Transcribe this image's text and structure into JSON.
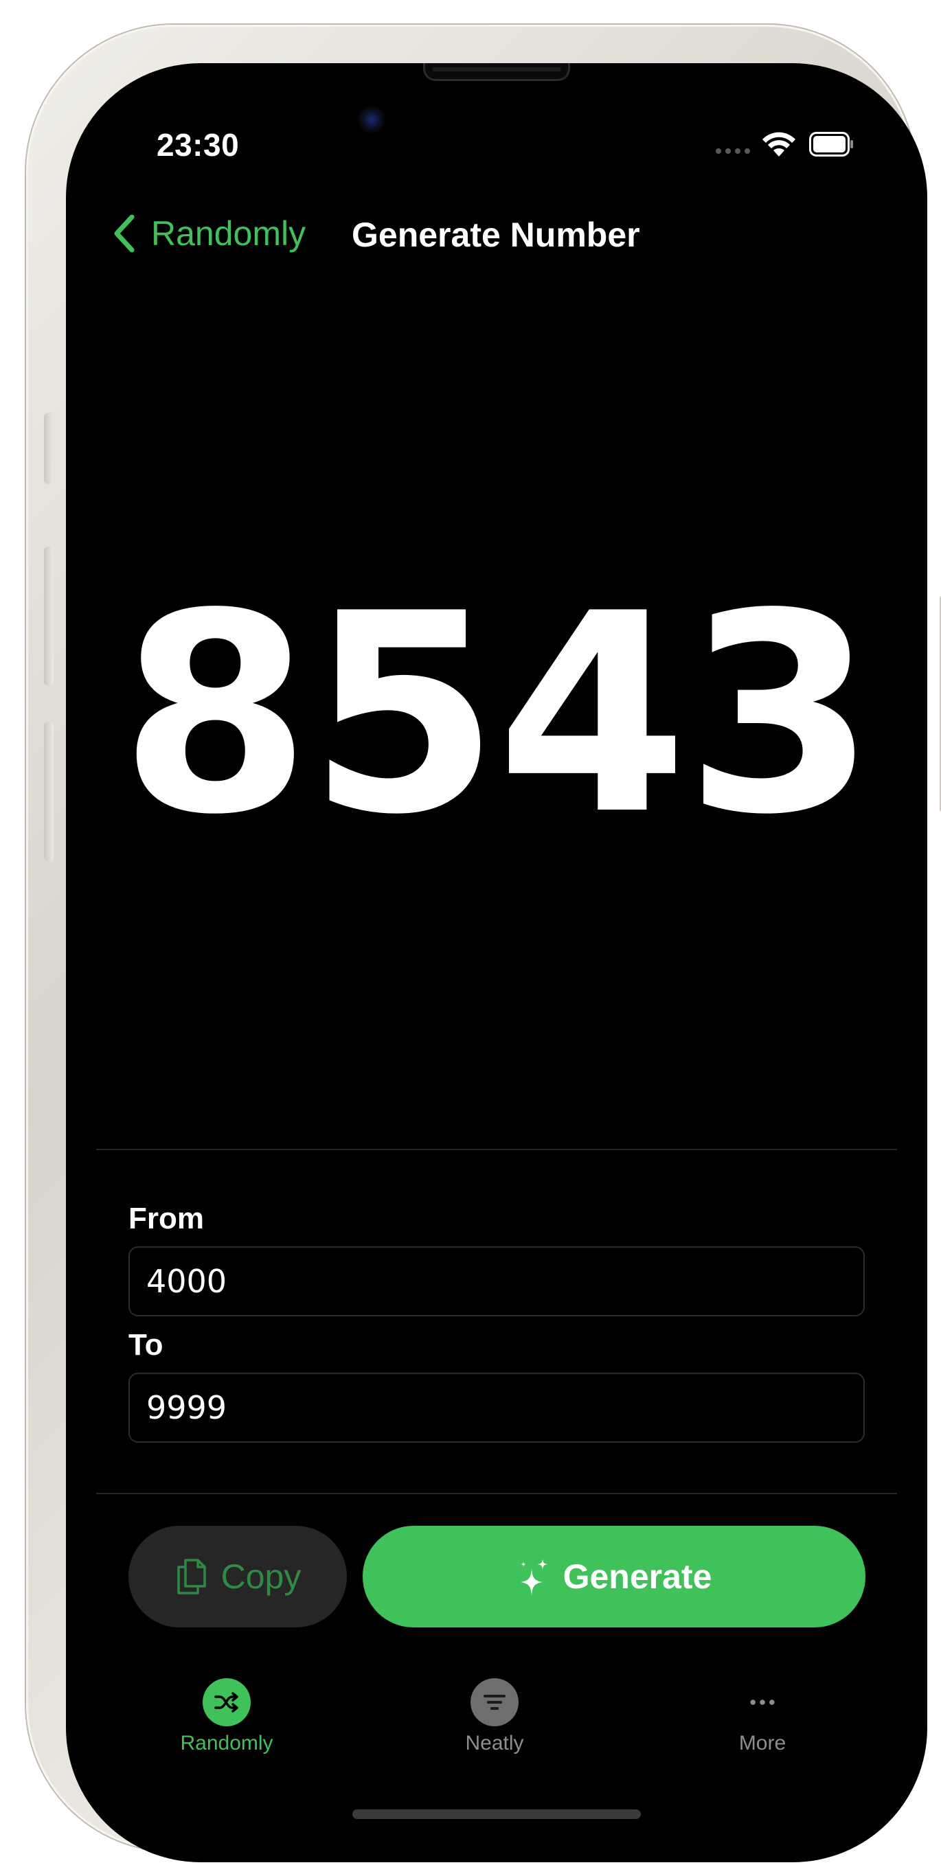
{
  "status_bar": {
    "time": "23:30"
  },
  "nav": {
    "back_label": "Randomly",
    "title": "Generate Number"
  },
  "result": {
    "number": "8543"
  },
  "range": {
    "from_label": "From",
    "from_value": "4000",
    "to_label": "To",
    "to_value": "9999"
  },
  "actions": {
    "copy_label": "Copy",
    "generate_label": "Generate"
  },
  "tabs": [
    {
      "label": "Randomly",
      "icon": "shuffle-icon",
      "active": true
    },
    {
      "label": "Neatly",
      "icon": "filter-icon",
      "active": false
    },
    {
      "label": "More",
      "icon": "more-dots-icon",
      "active": false
    }
  ],
  "colors": {
    "accent": "#3fc25a",
    "background": "#000000",
    "copy_button_bg": "#262626"
  }
}
